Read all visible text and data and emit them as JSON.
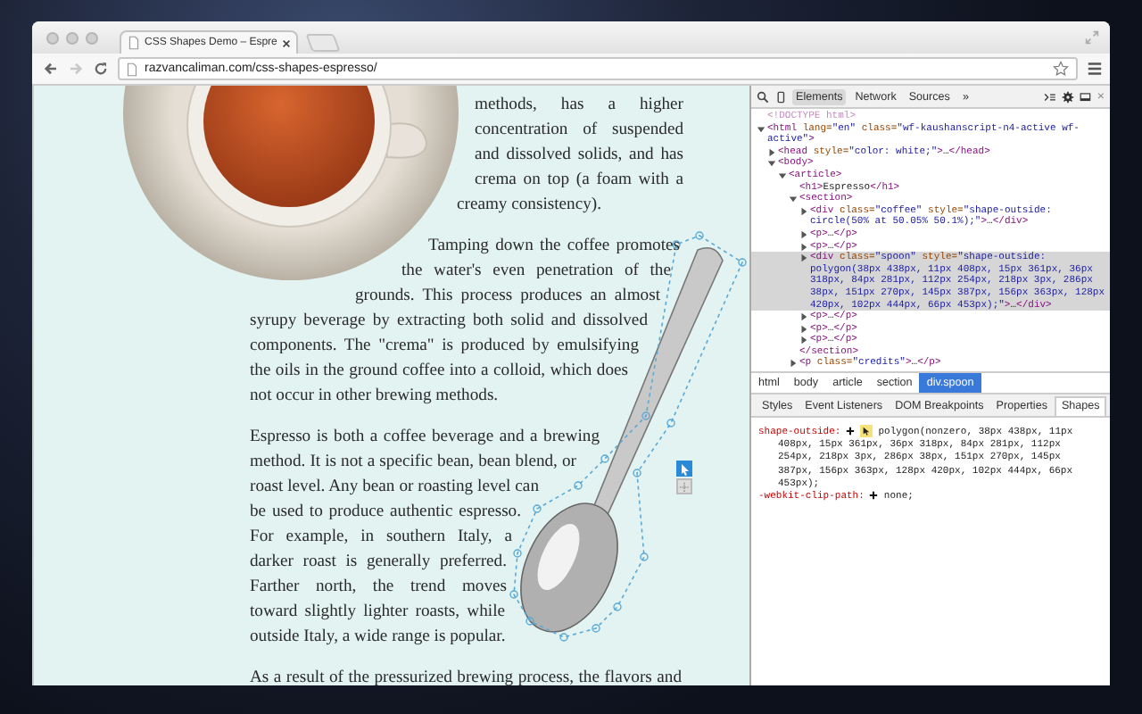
{
  "browser": {
    "tab_title": "CSS Shapes Demo – Espre",
    "url": "razvancaliman.com/css-shapes-espresso/",
    "nav": [
      {
        "kind": "back",
        "disabled": false
      },
      {
        "kind": "forward",
        "disabled": true
      },
      {
        "kind": "reload",
        "disabled": false
      }
    ]
  },
  "article": {
    "paragraphs": [
      {
        "lines": [
          "methods, has a higher",
          "concentration of suspended",
          "and dissolved solids, and has",
          "crema on top (a foam with a",
          "creamy consistency)."
        ]
      },
      {
        "lines": [
          "Tamping down the coffee promotes",
          "the water's even penetration of the",
          "grounds. This process produces an almost",
          "syrupy beverage by extracting both solid and dissolved",
          "components. The \"crema\" is produced by emulsifying",
          "the oils in the ground coffee into a colloid, which does",
          "not occur in other brewing methods."
        ]
      },
      {
        "lines": [
          "Espresso is both a coffee beverage and a brewing",
          "method. It is not a specific bean, bean blend, or",
          "roast level. Any bean or roasting level can",
          "be used to produce authentic espresso.",
          "For example, in southern Italy, a",
          "darker roast is generally preferred.",
          "Farther north, the trend moves",
          "toward slightly lighter roasts, while",
          "outside Italy, a wide range is popular."
        ]
      },
      {
        "lines": [
          "As a result of the pressurized brewing process, the flavors and"
        ]
      }
    ]
  },
  "devtools": {
    "tabs": [
      {
        "label": "Elements",
        "selected": true
      },
      {
        "label": "Network",
        "selected": false
      },
      {
        "label": "Sources",
        "selected": false
      }
    ],
    "overflow": "»",
    "close": "×",
    "dom_tree": [
      {
        "kind": "leaf",
        "selected": false,
        "lines": [
          "<!DOCTYPE html>"
        ]
      },
      {
        "kind": "element",
        "expanded": true,
        "selected": false,
        "lines": [
          "<html lang=\"en\" class=\"wf-kaushanscript-n4-active wf-",
          "active\">"
        ],
        "children": [
          {
            "kind": "element",
            "expanded": false,
            "selected": false,
            "lines": [
              "<head style=\"color: white;\">…</head>"
            ]
          },
          {
            "kind": "element",
            "expanded": true,
            "selected": false,
            "lines": [
              "<body>"
            ],
            "children": [
              {
                "kind": "element",
                "expanded": true,
                "selected": false,
                "lines": [
                  "<article>"
                ],
                "children": [
                  {
                    "kind": "leaf",
                    "selected": false,
                    "lines": [
                      "<h1>Espresso</h1>"
                    ]
                  },
                  {
                    "kind": "element",
                    "expanded": true,
                    "selected": false,
                    "lines": [
                      "<section>"
                    ],
                    "closing": "</section>",
                    "children": [
                      {
                        "kind": "element",
                        "expanded": false,
                        "selected": false,
                        "lines": [
                          "<div class=\"coffee\" style=\"shape-outside:",
                          "circle(50% at 50.05% 50.1%);\">…</div>"
                        ]
                      },
                      {
                        "kind": "element",
                        "expanded": false,
                        "selected": false,
                        "lines": [
                          "<p>…</p>"
                        ]
                      },
                      {
                        "kind": "element",
                        "expanded": false,
                        "selected": false,
                        "lines": [
                          "<p>…</p>"
                        ]
                      },
                      {
                        "kind": "element",
                        "expanded": false,
                        "selected": true,
                        "lines": [
                          "<div class=\"spoon\" style=\"shape-outside:",
                          "polygon(38px 438px, 11px 408px, 15px 361px, 36px",
                          "318px, 84px 281px, 112px 254px, 218px 3px, 286px",
                          "38px, 151px 270px, 145px 387px, 156px 363px, 128px",
                          "420px, 102px 444px, 66px 453px);\">…</div>"
                        ]
                      },
                      {
                        "kind": "element",
                        "expanded": false,
                        "selected": false,
                        "lines": [
                          "<p>…</p>"
                        ]
                      },
                      {
                        "kind": "element",
                        "expanded": false,
                        "selected": false,
                        "lines": [
                          "<p>…</p>"
                        ]
                      },
                      {
                        "kind": "element",
                        "expanded": false,
                        "selected": false,
                        "lines": [
                          "<p>…</p>"
                        ]
                      }
                    ]
                  },
                  {
                    "kind": "element",
                    "expanded": false,
                    "selected": false,
                    "lines": [
                      "<p class=\"credits\">…</p>"
                    ]
                  }
                ]
              }
            ]
          }
        ]
      }
    ],
    "breadcrumbs": [
      {
        "label": "html",
        "selected": false
      },
      {
        "label": "body",
        "selected": false
      },
      {
        "label": "article",
        "selected": false
      },
      {
        "label": "section",
        "selected": false
      },
      {
        "label": "div.spoon",
        "selected": true
      }
    ],
    "pane_tabs": [
      {
        "label": "Styles",
        "selected": false
      },
      {
        "label": "Event Listeners",
        "selected": false
      },
      {
        "label": "DOM Breakpoints",
        "selected": false
      },
      {
        "label": "Properties",
        "selected": false
      },
      {
        "label": "Shapes",
        "selected": true
      }
    ],
    "shapes": [
      {
        "property": "shape-outside:",
        "editor": true,
        "lines": [
          "polygon(nonzero, 38px 438px, 11px",
          "408px, 15px 361px, 36px 318px, 84px 281px, 112px",
          "254px, 218px 3px, 286px 38px, 151px 270px, 145px",
          "387px, 156px 363px, 128px 420px, 102px 444px, 66px",
          "453px);"
        ]
      },
      {
        "property": "-webkit-clip-path:",
        "editor": false,
        "lines": [
          "none;"
        ]
      }
    ]
  }
}
